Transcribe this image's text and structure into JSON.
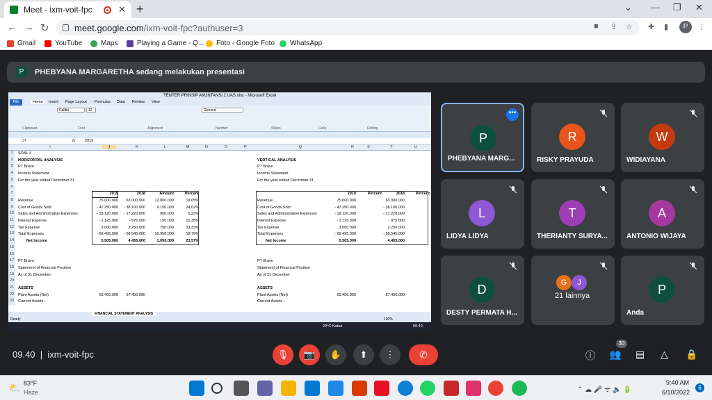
{
  "browser": {
    "tab_title": "Meet - ixm-voit-fpc",
    "url_host": "meet.google.com",
    "url_path": "/ixm-voit-fpc?authuser=3",
    "profile_initial": "P",
    "bookmarks": [
      "Gmail",
      "YouTube",
      "Maps",
      "Playing a Game - Q...",
      "Foto - Google Foto",
      "WhatsApp"
    ]
  },
  "meet": {
    "presenter_initial": "P",
    "presenting_text": "PHEBYANA MARGARETHA sedang melakukan presentasi",
    "meeting_time": "09.40",
    "meeting_code": "ixm-voit-fpc",
    "participant_count": "30",
    "tiles": [
      {
        "initial": "P",
        "name": "PHEBYANA MARG...",
        "color": "#0d4f3c"
      },
      {
        "initial": "R",
        "name": "RISKY PRAYUDA",
        "color": "#e8541c"
      },
      {
        "initial": "W",
        "name": "WIDIAYANA",
        "color": "#c43a0e"
      },
      {
        "initial": "L",
        "name": "LIDYA LIDYA",
        "color": "#8e57d6"
      },
      {
        "initial": "T",
        "name": "THERIANTY SURYA...",
        "color": "#9c3fb5"
      },
      {
        "initial": "A",
        "name": "ANTONIO WIJAYA",
        "color": "#a3399d"
      },
      {
        "initial": "D",
        "name": "DESTY PERMATA H...",
        "color": "#0d4f3c"
      },
      {
        "initial": "",
        "name": "21 lainnya",
        "color": ""
      },
      {
        "initial": "P",
        "name": "Anda",
        "color": "#0d4f3c"
      }
    ],
    "others_initials": [
      "G",
      "J"
    ]
  },
  "excel": {
    "title": "TENTER PRINSIP AKUNTANSI 2 UAS.xlsx - Microsoft Excel",
    "menu_tabs": [
      "Home",
      "Insert",
      "Page Layout",
      "Formulas",
      "Data",
      "Review",
      "View"
    ],
    "file_label": "File",
    "name_box": "J7",
    "formula": "2019",
    "font_name": "Calibri",
    "font_size": "12",
    "format": "General",
    "groups": [
      "Clipboard",
      "Font",
      "Alignment",
      "Number",
      "Styles",
      "Cells",
      "Editing"
    ],
    "columns": [
      "I",
      "J",
      "K",
      "L",
      "M",
      "N",
      "O",
      "P",
      "Q",
      "R",
      "S",
      "T",
      "U"
    ],
    "rows": [
      "1",
      "2",
      "3",
      "4",
      "5",
      "6",
      "7",
      "8",
      "9",
      "10",
      "11",
      "12",
      "13",
      "14",
      "15",
      "16",
      "17",
      "18",
      "19",
      "20",
      "21",
      "22",
      "23"
    ],
    "soal": "SOAL 4",
    "horiz": {
      "title": "HORIZONTAL ANALYSIS",
      "company": "PT Bravo",
      "statement": "Income Statement",
      "period": "For the year ended December 31",
      "headers": [
        "2019",
        "2018",
        "Amount",
        "Percent"
      ],
      "lines": [
        [
          "Revenue",
          "75.000.000",
          "63.000.000",
          "12.000.000",
          "19,05%"
        ],
        [
          "Cost of Goods Sold",
          "- 47.250.000",
          "- 38.100.000",
          "9.150.000",
          "24,02%"
        ],
        [
          "Sales and Administrative Expenses",
          "- 18.120.000",
          "- 17.220.000",
          "900.000",
          "5,23%"
        ],
        [
          "Interest Expense",
          "- 1.125.000",
          "- 975.000",
          "150.000",
          "15,38%"
        ],
        [
          "Tax Expense",
          "3.000.000",
          "2.250.000",
          "750.000",
          "33,33%"
        ],
        [
          "Total Expenses",
          "- 69.495.000",
          "- 58.545.000",
          "10.950.000",
          "18,70%"
        ],
        [
          "Net Income",
          "5.505.000",
          "4.455.000",
          "1.050.000",
          "23,57%"
        ]
      ],
      "bs_company": "PT Bravo",
      "bs_statement": "Statement of Financial Position",
      "bs_period": "As of 31 December",
      "assets": "ASSETS",
      "plant": [
        "Plant Assets (Net)",
        "63.450.000",
        "57.450.000"
      ],
      "current": "Current Assets :"
    },
    "vert": {
      "title": "VERTICAL ANALYSIS",
      "company": "PT Bravo",
      "statement": "Income Statement",
      "period": "For the year ended December 31",
      "headers": [
        "2019",
        "Percent",
        "2018",
        "Percent"
      ],
      "lines": [
        [
          "Revenue",
          "75.000.000",
          "63.000.000"
        ],
        [
          "Cost of Goods Sold",
          "- 47.250.000",
          "- 38.100.000"
        ],
        [
          "Sales and Administrative Expenses",
          "- 18.120.000",
          "- 17.220.000"
        ],
        [
          "Interest Expense",
          "- 1.125.000",
          "- 975.000"
        ],
        [
          "Tax Expense",
          "3.000.000",
          "2.250.000"
        ],
        [
          "Total Expenses",
          "- 69.495.000",
          "- 58.545.000"
        ],
        [
          "Net Income",
          "5.505.000",
          "4.455.000"
        ]
      ],
      "bs_company": "PT Bravo",
      "bs_statement": "Statement of Financial Position",
      "bs_period": "As of 31 December",
      "assets": "ASSETS",
      "plant": [
        "Plant Assets (Net)",
        "63.450.000",
        "57.450.000"
      ],
      "current": "Current Assets :"
    },
    "sheet_tab": "FINANCIAL STATEMENT ANALYSIS",
    "status_ready": "Ready",
    "zoom": "100%",
    "inner_weather": "29°C Kabut",
    "inner_time": "09.40"
  },
  "taskbar": {
    "temp": "83°F",
    "weather": "Haze",
    "time": "9:40 AM",
    "date": "6/10/2022",
    "notifications": "6"
  }
}
